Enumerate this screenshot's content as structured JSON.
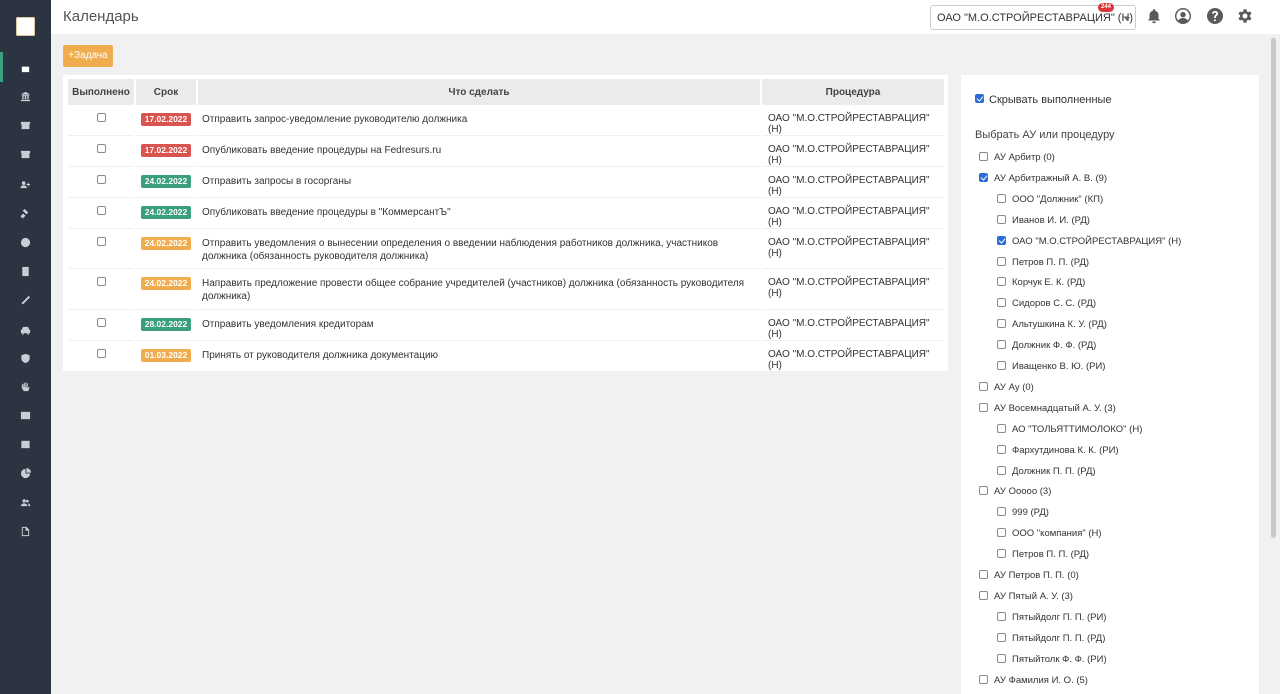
{
  "header": {
    "title": "Календарь",
    "org_select": "ОАО \"М.О.СТРОЙРЕСТАВРАЦИЯ\" (Н)",
    "notifications_count": "244",
    "icons": [
      "bell-icon",
      "user-icon",
      "help-icon",
      "gear-icon"
    ]
  },
  "sidebar": {
    "icons": [
      "calendar-icon",
      "bank-icon",
      "archive-icon",
      "archive-icon",
      "user-plus-icon",
      "gavel-icon",
      "dollar-icon",
      "calculator-icon",
      "pen-icon",
      "car-icon",
      "shield-icon",
      "hand-icon",
      "table-icon",
      "list-icon",
      "chart-pie-icon",
      "users-icon",
      "file-icon"
    ]
  },
  "toolbar": {
    "add_task": "+Задача"
  },
  "table": {
    "headers": [
      "Выполнено",
      "Срок",
      "Что сделать",
      "Процедура"
    ],
    "rows": [
      {
        "date": "17.02.2022",
        "color": "#d9534f",
        "task": "Отправить запрос-уведомление руководителю должника",
        "procedure": "ОАО \"М.О.СТРОЙРЕСТАВРАЦИЯ\" (Н)"
      },
      {
        "date": "17.02.2022",
        "color": "#d9534f",
        "task": "Опубликовать введение процедуры на Fedresurs.ru",
        "procedure": "ОАО \"М.О.СТРОЙРЕСТАВРАЦИЯ\" (Н)"
      },
      {
        "date": "24.02.2022",
        "color": "#3a9f7a",
        "task": "Отправить запросы в госорганы",
        "procedure": "ОАО \"М.О.СТРОЙРЕСТАВРАЦИЯ\" (Н)"
      },
      {
        "date": "24.02.2022",
        "color": "#3a9f7a",
        "task": "Опубликовать введение процедуры в \"КоммерсантЪ\"",
        "procedure": "ОАО \"М.О.СТРОЙРЕСТАВРАЦИЯ\" (Н)"
      },
      {
        "date": "24.02.2022",
        "color": "#f0ad4e",
        "task": "Отправить уведомления о вынесении определения о введении наблюдения работников должника, участников должника (обязанность руководителя должника)",
        "procedure": "ОАО \"М.О.СТРОЙРЕСТАВРАЦИЯ\" (Н)"
      },
      {
        "date": "24.02.2022",
        "color": "#f0ad4e",
        "task": "Направить предложение провести общее собрание учредителей (участников) должника (обязанность руководителя должника)",
        "procedure": "ОАО \"М.О.СТРОЙРЕСТАВРАЦИЯ\" (Н)"
      },
      {
        "date": "28.02.2022",
        "color": "#3a9f7a",
        "task": "Отправить уведомления кредиторам",
        "procedure": "ОАО \"М.О.СТРОЙРЕСТАВРАЦИЯ\" (Н)"
      },
      {
        "date": "01.03.2022",
        "color": "#f0ad4e",
        "task": "Принять от руководителя должника документацию",
        "procedure": "ОАО \"М.О.СТРОЙРЕСТАВРАЦИЯ\" (Н)"
      }
    ]
  },
  "filter": {
    "hide_completed_label": "Скрывать выполненные",
    "hide_completed_checked": true,
    "choose_label": "Выбрать АУ или процедуру",
    "tree": [
      {
        "label": "АУ Арбитр (0)",
        "level": 0,
        "checked": false
      },
      {
        "label": "АУ Арбитражный А. В. (9)",
        "level": 0,
        "checked": true
      },
      {
        "label": "ООО \"Должник\" (КП)",
        "level": 1,
        "checked": false
      },
      {
        "label": "Иванов И. И. (РД)",
        "level": 1,
        "checked": false
      },
      {
        "label": "ОАО \"М.О.СТРОЙРЕСТАВРАЦИЯ\" (Н)",
        "level": 1,
        "checked": true
      },
      {
        "label": "Петров П. П. (РД)",
        "level": 1,
        "checked": false
      },
      {
        "label": "Корчук Е. К. (РД)",
        "level": 1,
        "checked": false
      },
      {
        "label": "Сидоров С. С. (РД)",
        "level": 1,
        "checked": false
      },
      {
        "label": "Альтушкина К. У. (РД)",
        "level": 1,
        "checked": false
      },
      {
        "label": "Должник Ф. Ф. (РД)",
        "level": 1,
        "checked": false
      },
      {
        "label": "Иващенко В. Ю. (РИ)",
        "level": 1,
        "checked": false
      },
      {
        "label": "АУ Ау (0)",
        "level": 0,
        "checked": false
      },
      {
        "label": "АУ Восемнадцатый А. У. (3)",
        "level": 0,
        "checked": false
      },
      {
        "label": "АО \"ТОЛЬЯТТИМОЛОКО\" (Н)",
        "level": 1,
        "checked": false
      },
      {
        "label": "Фархутдинова К. К. (РИ)",
        "level": 1,
        "checked": false
      },
      {
        "label": "Должник П. П. (РД)",
        "level": 1,
        "checked": false
      },
      {
        "label": "АУ Ооооо (3)",
        "level": 0,
        "checked": false
      },
      {
        "label": "999 (РД)",
        "level": 1,
        "checked": false
      },
      {
        "label": "ООО \"компания\" (Н)",
        "level": 1,
        "checked": false
      },
      {
        "label": "Петров П. П. (РД)",
        "level": 1,
        "checked": false
      },
      {
        "label": "АУ Петров П. П. (0)",
        "level": 0,
        "checked": false
      },
      {
        "label": "АУ Пятый А. У. (3)",
        "level": 0,
        "checked": false
      },
      {
        "label": "Пятыйдолг П. П. (РИ)",
        "level": 1,
        "checked": false
      },
      {
        "label": "Пятыйдолг П. П. (РД)",
        "level": 1,
        "checked": false
      },
      {
        "label": "Пятыйтолк Ф. Ф. (РИ)",
        "level": 1,
        "checked": false
      },
      {
        "label": "АУ Фамилия И. О. (5)",
        "level": 0,
        "checked": false
      }
    ]
  }
}
